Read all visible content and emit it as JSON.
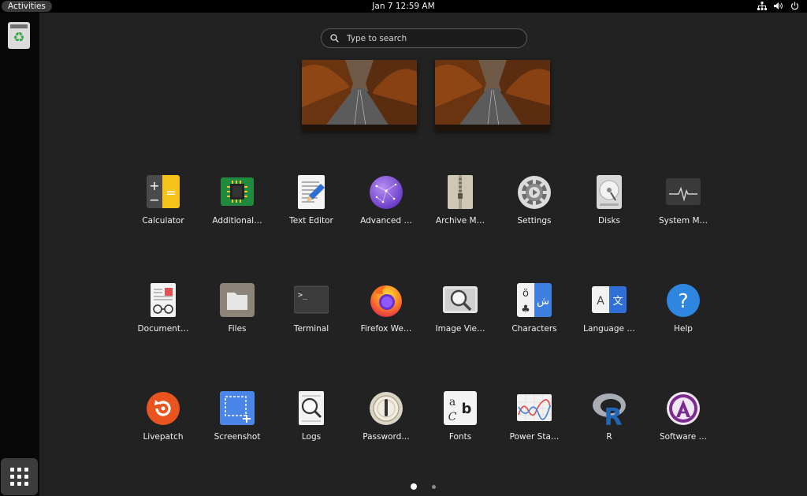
{
  "topbar": {
    "activities": "Activities",
    "clock": "Jan 7  12:59 AM",
    "tray_icons": [
      "network-icon",
      "volume-icon",
      "power-icon"
    ]
  },
  "dock": {
    "items": [
      {
        "name": "trash",
        "icon": "recycle-icon",
        "symbol": "♻"
      },
      {
        "name": "show-applications",
        "icon": "grid-icon"
      }
    ]
  },
  "search": {
    "placeholder": "Type to search"
  },
  "workspaces": [
    {
      "name": "workspace-1"
    },
    {
      "name": "workspace-2"
    }
  ],
  "apps": [
    {
      "label": "Calculator",
      "icon": "calculator-icon"
    },
    {
      "label": "Additional…",
      "icon": "chip-icon"
    },
    {
      "label": "Text Editor",
      "icon": "text-editor-icon"
    },
    {
      "label": "Advanced …",
      "icon": "advanced-icon"
    },
    {
      "label": "Archive M…",
      "icon": "archive-icon"
    },
    {
      "label": "Settings",
      "icon": "settings-icon"
    },
    {
      "label": "Disks",
      "icon": "disks-icon"
    },
    {
      "label": "System M…",
      "icon": "system-monitor-icon"
    },
    {
      "label": "Document…",
      "icon": "document-viewer-icon"
    },
    {
      "label": "Files",
      "icon": "files-icon"
    },
    {
      "label": "Terminal",
      "icon": "terminal-icon"
    },
    {
      "label": "Firefox We…",
      "icon": "firefox-icon"
    },
    {
      "label": "Image Vie…",
      "icon": "image-viewer-icon"
    },
    {
      "label": "Characters",
      "icon": "characters-icon"
    },
    {
      "label": "Language …",
      "icon": "language-icon"
    },
    {
      "label": "Help",
      "icon": "help-icon"
    },
    {
      "label": "Livepatch",
      "icon": "livepatch-icon"
    },
    {
      "label": "Screenshot",
      "icon": "screenshot-icon"
    },
    {
      "label": "Logs",
      "icon": "logs-icon"
    },
    {
      "label": "Password…",
      "icon": "password-icon"
    },
    {
      "label": "Fonts",
      "icon": "fonts-icon"
    },
    {
      "label": "Power Sta…",
      "icon": "power-statistics-icon"
    },
    {
      "label": "R",
      "icon": "r-icon"
    },
    {
      "label": "Software …",
      "icon": "software-icon"
    }
  ],
  "glyphs": {
    "calc_plus": "+",
    "calc_minus": "−",
    "calc_eq": "=",
    "terminal_prompt": ">_",
    "char_o": "ö",
    "char_club": "♣",
    "char_arabic": "ش",
    "lang_a": "A",
    "lang_zh": "文",
    "help_q": "?",
    "fonts_a": "a",
    "fonts_c": "C",
    "fonts_b": "b",
    "r_letter": "R"
  },
  "pager": {
    "pages": 2,
    "current": 1
  }
}
